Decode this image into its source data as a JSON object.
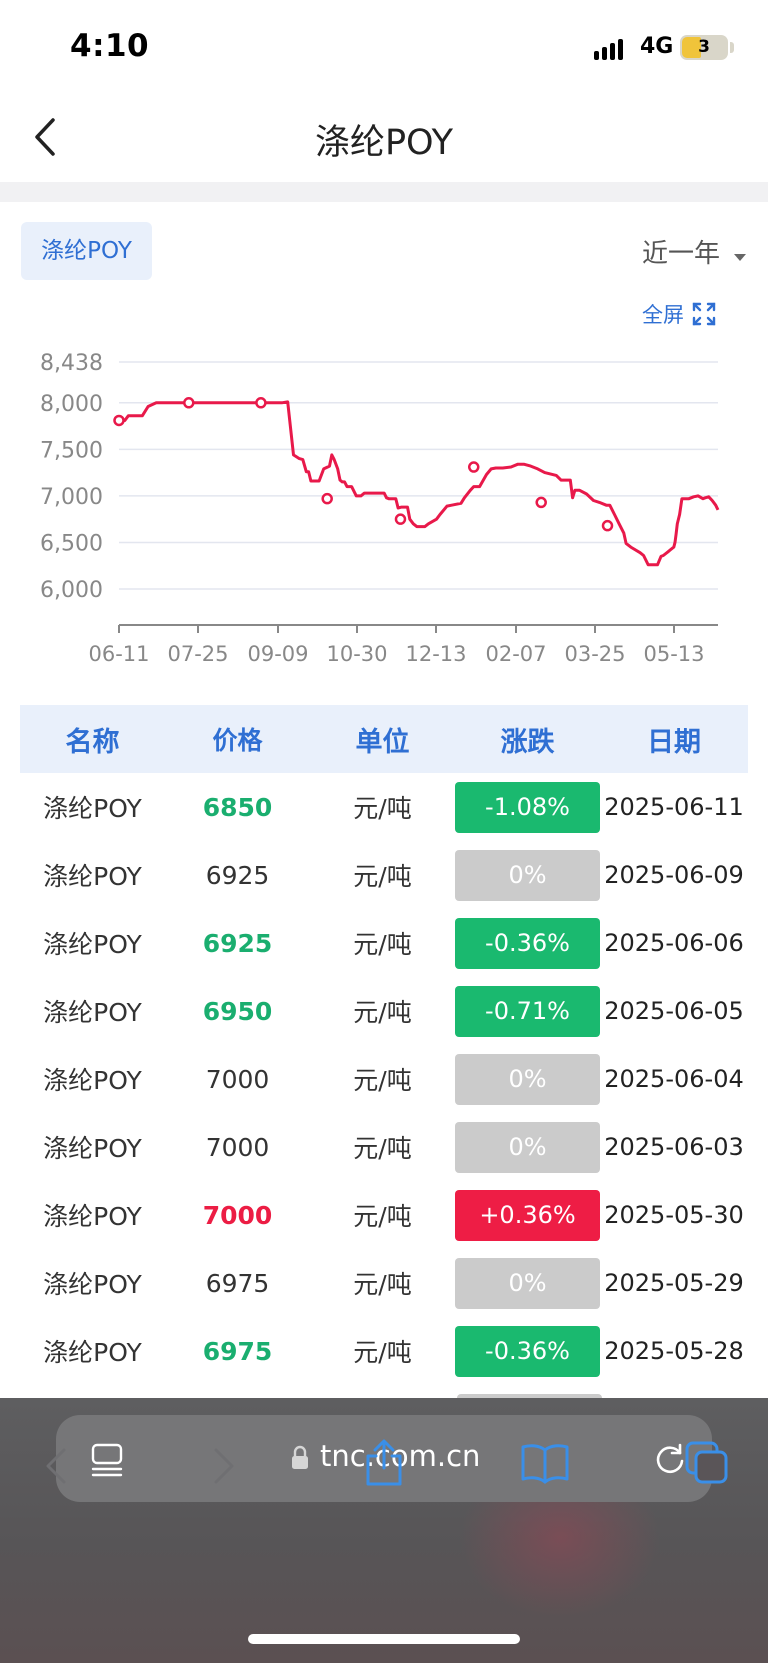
{
  "status": {
    "time": "4:10",
    "network": "4G",
    "battery": "3"
  },
  "header": {
    "title": "涤纶POY"
  },
  "chart_panel": {
    "chip_label": "涤纶POY",
    "range_label": "近一年",
    "fullscreen_label": "全屏"
  },
  "chart_data": {
    "type": "line",
    "title": "",
    "x_ticks": [
      "06-11",
      "07-25",
      "09-09",
      "10-30",
      "12-13",
      "02-07",
      "03-25",
      "05-13"
    ],
    "y_ticks": [
      6000,
      6500,
      7000,
      7500,
      8000,
      8438
    ],
    "ylim": [
      6000,
      8438
    ],
    "grid": true,
    "color": "#e8194a",
    "series": [
      {
        "values": [
          [
            0,
            7810
          ],
          [
            5,
            7810
          ],
          [
            8,
            7860
          ],
          [
            20,
            7860
          ],
          [
            25,
            7960
          ],
          [
            32,
            8000
          ],
          [
            70,
            8000
          ],
          [
            100,
            8000
          ],
          [
            140,
            8000
          ],
          [
            145,
            8010
          ],
          [
            150,
            7440
          ],
          [
            155,
            7400
          ],
          [
            158,
            7390
          ],
          [
            161,
            7260
          ],
          [
            163,
            7260
          ],
          [
            165,
            7160
          ],
          [
            172,
            7160
          ],
          [
            176,
            7290
          ],
          [
            181,
            7320
          ],
          [
            183,
            7440
          ],
          [
            185,
            7390
          ],
          [
            188,
            7290
          ],
          [
            190,
            7170
          ],
          [
            192,
            7150
          ],
          [
            194,
            7150
          ],
          [
            196,
            7100
          ],
          [
            200,
            7100
          ],
          [
            204,
            7000
          ],
          [
            208,
            7000
          ],
          [
            211,
            7030
          ],
          [
            218,
            7030
          ],
          [
            228,
            7030
          ],
          [
            230,
            6980
          ],
          [
            232,
            6970
          ],
          [
            238,
            6970
          ],
          [
            240,
            6870
          ],
          [
            243,
            6880
          ],
          [
            248,
            6880
          ],
          [
            250,
            6750
          ],
          [
            253,
            6700
          ],
          [
            256,
            6670
          ],
          [
            263,
            6670
          ],
          [
            266,
            6700
          ],
          [
            273,
            6750
          ],
          [
            276,
            6800
          ],
          [
            282,
            6890
          ],
          [
            286,
            6900
          ],
          [
            294,
            6920
          ],
          [
            297,
            6980
          ],
          [
            302,
            7060
          ],
          [
            305,
            7100
          ],
          [
            310,
            7100
          ],
          [
            316,
            7230
          ],
          [
            320,
            7290
          ],
          [
            324,
            7300
          ],
          [
            330,
            7300
          ],
          [
            337,
            7310
          ],
          [
            343,
            7340
          ],
          [
            348,
            7340
          ],
          [
            354,
            7320
          ],
          [
            360,
            7290
          ],
          [
            366,
            7250
          ],
          [
            376,
            7220
          ],
          [
            380,
            7170
          ],
          [
            388,
            7170
          ],
          [
            390,
            6980
          ],
          [
            392,
            7060
          ],
          [
            396,
            7060
          ],
          [
            402,
            7020
          ],
          [
            408,
            6950
          ],
          [
            413,
            6930
          ],
          [
            419,
            6900
          ],
          [
            422,
            6900
          ],
          [
            426,
            6800
          ],
          [
            430,
            6700
          ],
          [
            434,
            6600
          ],
          [
            436,
            6490
          ],
          [
            440,
            6450
          ],
          [
            444,
            6420
          ],
          [
            448,
            6390
          ],
          [
            451,
            6360
          ],
          [
            455,
            6260
          ],
          [
            463,
            6260
          ],
          [
            466,
            6350
          ],
          [
            468,
            6360
          ],
          [
            472,
            6400
          ],
          [
            474,
            6420
          ],
          [
            477,
            6450
          ],
          [
            478,
            6500
          ],
          [
            479,
            6590
          ],
          [
            480,
            6700
          ],
          [
            482,
            6800
          ],
          [
            484,
            6970
          ],
          [
            490,
            6970
          ],
          [
            494,
            6990
          ],
          [
            498,
            7000
          ],
          [
            502,
            6970
          ],
          [
            504,
            6980
          ],
          [
            507,
            6990
          ],
          [
            510,
            6950
          ],
          [
            513,
            6900
          ],
          [
            515,
            6850
          ]
        ],
        "markers": [
          [
            0,
            7810
          ],
          [
            60,
            8000
          ],
          [
            122,
            8000
          ],
          [
            179,
            6970
          ],
          [
            242,
            6750
          ],
          [
            305,
            7310
          ],
          [
            363,
            6930
          ],
          [
            420,
            6680
          ]
        ]
      }
    ]
  },
  "table": {
    "headers": [
      "名称",
      "价格",
      "单位",
      "涨跌",
      "日期"
    ],
    "rows": [
      {
        "name": "涤纶POY",
        "price": "6850",
        "unit": "元/吨",
        "change": "-1.08%",
        "date": "2025-06-11"
      },
      {
        "name": "涤纶POY",
        "price": "6925",
        "unit": "元/吨",
        "change": "0%",
        "date": "2025-06-09"
      },
      {
        "name": "涤纶POY",
        "price": "6925",
        "unit": "元/吨",
        "change": "-0.36%",
        "date": "2025-06-06"
      },
      {
        "name": "涤纶POY",
        "price": "6950",
        "unit": "元/吨",
        "change": "-0.71%",
        "date": "2025-06-05"
      },
      {
        "name": "涤纶POY",
        "price": "7000",
        "unit": "元/吨",
        "change": "0%",
        "date": "2025-06-04"
      },
      {
        "name": "涤纶POY",
        "price": "7000",
        "unit": "元/吨",
        "change": "0%",
        "date": "2025-06-03"
      },
      {
        "name": "涤纶POY",
        "price": "7000",
        "unit": "元/吨",
        "change": "+0.36%",
        "date": "2025-05-30"
      },
      {
        "name": "涤纶POY",
        "price": "6975",
        "unit": "元/吨",
        "change": "0%",
        "date": "2025-05-29"
      },
      {
        "name": "涤纶POY",
        "price": "6975",
        "unit": "元/吨",
        "change": "-0.36%",
        "date": "2025-05-28"
      }
    ]
  },
  "browser": {
    "url": "tnc.com.cn"
  },
  "colors": {
    "accent": "#2f6fd3",
    "down": "#1ab96f",
    "up": "#ee1d45",
    "flat": "#cbcbcb"
  },
  "icons": {
    "back": "chevron-left-icon",
    "fullscreen": "expand-icon",
    "reader": "reader-mode-icon",
    "lock": "lock-icon",
    "reload": "reload-icon",
    "browser_back": "chevron-left-icon",
    "browser_forward": "chevron-right-icon",
    "share": "share-icon",
    "bookmarks": "book-icon",
    "tabs": "tabs-icon"
  }
}
